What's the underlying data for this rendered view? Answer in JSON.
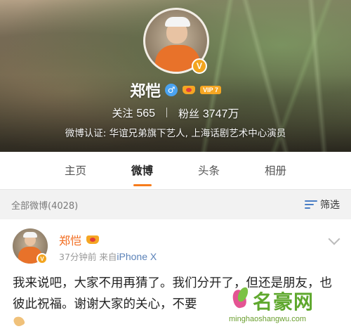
{
  "profile": {
    "name": "郑恺",
    "vip_label": "VIP 7",
    "verified_badge": "V",
    "following_label": "关注",
    "following_count": "565",
    "fans_label": "粉丝",
    "fans_count": "3747万",
    "verification": "微博认证: 华谊兄弟旗下艺人, 上海话剧艺术中心演员"
  },
  "tabs": [
    {
      "label": "主页",
      "active": false
    },
    {
      "label": "微博",
      "active": true
    },
    {
      "label": "头条",
      "active": false
    },
    {
      "label": "相册",
      "active": false
    }
  ],
  "filterbar": {
    "count_label": "全部微博(4028)",
    "filter_label": "筛选"
  },
  "post": {
    "author": "郑恺",
    "time": "37分钟前",
    "source_prefix": "来自",
    "source": "iPhone X",
    "text": "我来说吧，大家不用再猜了。我们分开了，但还是朋友，也彼此祝福。谢谢大家的关心，不要",
    "verified_badge": "V"
  },
  "watermark": {
    "title": "名豪网",
    "url": "minghaoshangwu.com"
  },
  "colors": {
    "accent": "#f77c1c",
    "author": "#f26b1d",
    "link": "#5b82b8",
    "verified": "#f3a51f"
  }
}
